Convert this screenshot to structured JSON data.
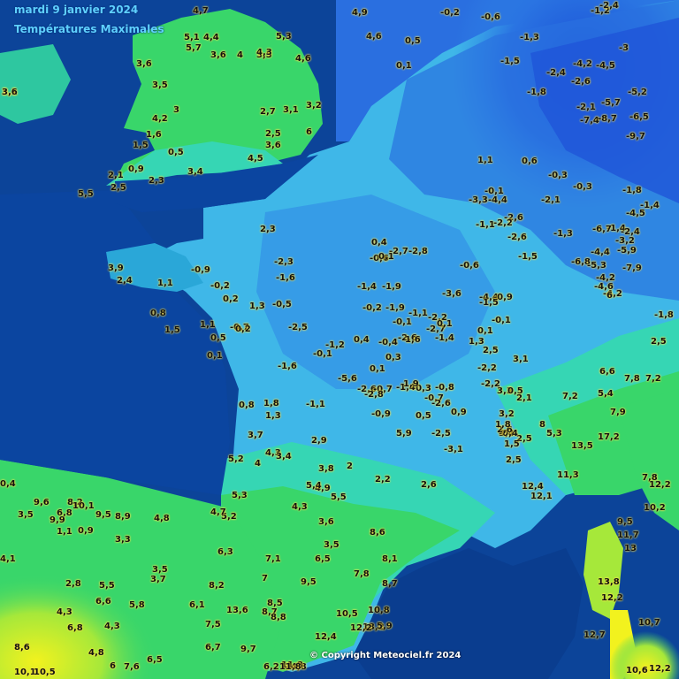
{
  "header": {
    "title": "mardi 9 janvier 2024",
    "subtitle": "Températures Maximales"
  },
  "footer": {
    "copyright": "© Copyright Meteociel.fr 2024"
  },
  "colors": {
    "sea": "#0a3d8f",
    "deep_cold": "#1a4fd6",
    "cold": "#2f86e6",
    "near_zero": "#3fb7e8",
    "mild": "#36d6b4",
    "warm": "#39d66a",
    "warmer": "#a6e83a",
    "hot": "#f2f21e",
    "label_text": "#111111",
    "label_halo": "#ffe14a"
  },
  "values": [
    {
      "t": "3,1"
    },
    {
      "t": "5,5"
    },
    {
      "t": "4,7"
    },
    {
      "t": "3,6"
    },
    {
      "t": "3,5"
    },
    {
      "t": "4,2"
    },
    {
      "t": "1,6"
    },
    {
      "t": "1,5"
    },
    {
      "t": "0,5"
    },
    {
      "t": "3"
    },
    {
      "t": "3,4"
    },
    {
      "t": "2,5"
    },
    {
      "t": "2,3"
    },
    {
      "t": "0,9"
    },
    {
      "t": "2,1"
    },
    {
      "t": "5,1"
    },
    {
      "t": "4,4"
    },
    {
      "t": "5,7"
    },
    {
      "t": "3,6"
    },
    {
      "t": "4"
    },
    {
      "t": "3,5"
    },
    {
      "t": "3,2"
    },
    {
      "t": "6"
    },
    {
      "t": "4,5"
    },
    {
      "t": "3,6"
    },
    {
      "t": "2,7"
    },
    {
      "t": "3,1"
    },
    {
      "t": "2,5"
    },
    {
      "t": "4,3"
    },
    {
      "t": "4,6"
    },
    {
      "t": "5,3"
    },
    {
      "t": "4,9"
    },
    {
      "t": "4,6"
    },
    {
      "t": "0,5"
    },
    {
      "t": "-0,2"
    },
    {
      "t": "0,1"
    },
    {
      "t": "-0,6"
    },
    {
      "t": "-1,3"
    },
    {
      "t": "-1,2"
    },
    {
      "t": "-2,4"
    },
    {
      "t": "-3"
    },
    {
      "t": "-4,2"
    },
    {
      "t": "-4,5"
    },
    {
      "t": "-5,2"
    },
    {
      "t": "-6,5"
    },
    {
      "t": "-7,4"
    },
    {
      "t": "-8,7"
    },
    {
      "t": "-9,7"
    },
    {
      "t": "-5,7"
    },
    {
      "t": "-2,4"
    },
    {
      "t": "-2,6"
    },
    {
      "t": "-1,5"
    },
    {
      "t": "-1,8"
    },
    {
      "t": "-2,1"
    },
    {
      "t": "-0,3"
    },
    {
      "t": "-1,4"
    },
    {
      "t": "-3,2"
    },
    {
      "t": "-5,9"
    },
    {
      "t": "-7,9"
    },
    {
      "t": "-6,8"
    },
    {
      "t": "-4,4"
    },
    {
      "t": "-4,2"
    },
    {
      "t": "-2,4"
    },
    {
      "t": "-1,8"
    },
    {
      "t": "-1,9"
    },
    {
      "t": "-2,7"
    },
    {
      "t": "-2,8"
    },
    {
      "t": "-2,3"
    },
    {
      "t": "-1,6"
    },
    {
      "t": "-0,5"
    },
    {
      "t": "-2,5"
    },
    {
      "t": "-1,2"
    },
    {
      "t": "-0,6"
    },
    {
      "t": "-0,2"
    },
    {
      "t": "0,4"
    },
    {
      "t": "-0,1"
    },
    {
      "t": "0,1"
    },
    {
      "t": "-0,8"
    },
    {
      "t": "-1,9"
    },
    {
      "t": "-2,6"
    },
    {
      "t": "-2,2"
    },
    {
      "t": "-1,4"
    },
    {
      "t": "-0,4"
    },
    {
      "t": "0,3"
    },
    {
      "t": "-0,3"
    },
    {
      "t": "0,9"
    },
    {
      "t": "1,3"
    },
    {
      "t": "0,8"
    },
    {
      "t": "1,5"
    },
    {
      "t": "2,3"
    },
    {
      "t": "3,9"
    },
    {
      "t": "2,4"
    },
    {
      "t": "1,1"
    },
    {
      "t": "-0,9"
    },
    {
      "t": "-0,2"
    },
    {
      "t": "0,2"
    },
    {
      "t": "1,1"
    },
    {
      "t": "0,1"
    },
    {
      "t": "0,5"
    },
    {
      "t": "-0,7"
    },
    {
      "t": "0,2"
    },
    {
      "t": "-1,6"
    },
    {
      "t": "-1,1"
    },
    {
      "t": "-0,9"
    },
    {
      "t": "-5,6"
    },
    {
      "t": "-2,6"
    },
    {
      "t": "-1,4"
    },
    {
      "t": "-0,7"
    },
    {
      "t": "0,8"
    },
    {
      "t": "1,3"
    },
    {
      "t": "1,8"
    },
    {
      "t": "2,9"
    },
    {
      "t": "3,7"
    },
    {
      "t": "4"
    },
    {
      "t": "5,2"
    },
    {
      "t": "4,3"
    },
    {
      "t": "3,4"
    },
    {
      "t": "3,8"
    },
    {
      "t": "2"
    },
    {
      "t": "2,2"
    },
    {
      "t": "2,6"
    },
    {
      "t": "4,9"
    },
    {
      "t": "5,4"
    },
    {
      "t": "5,5"
    },
    {
      "t": "4,3"
    },
    {
      "t": "3,6"
    },
    {
      "t": "3,5"
    },
    {
      "t": "5,2"
    },
    {
      "t": "5,3"
    },
    {
      "t": "4,7"
    },
    {
      "t": "6,3"
    },
    {
      "t": "7,1"
    },
    {
      "t": "6,5"
    },
    {
      "t": "8,6"
    },
    {
      "t": "8,1"
    },
    {
      "t": "7,8"
    },
    {
      "t": "8,7"
    },
    {
      "t": "10,8"
    },
    {
      "t": "13,2"
    },
    {
      "t": "12,4"
    },
    {
      "t": "14,8"
    },
    {
      "t": "11,8"
    },
    {
      "t": "12,2"
    },
    {
      "t": "10,5"
    },
    {
      "t": "8,7"
    },
    {
      "t": "8,8"
    },
    {
      "t": "13,6"
    },
    {
      "t": "9,7"
    },
    {
      "t": "7,5"
    },
    {
      "t": "6,1"
    },
    {
      "t": "5,8"
    },
    {
      "t": "4,3"
    },
    {
      "t": "6,6"
    },
    {
      "t": "6,8"
    },
    {
      "t": "4,3"
    },
    {
      "t": "2,8"
    },
    {
      "t": "1,1"
    },
    {
      "t": "0,9"
    },
    {
      "t": "6,8"
    },
    {
      "t": "8,2"
    },
    {
      "t": "9,6"
    },
    {
      "t": "9,9"
    },
    {
      "t": "10,1"
    },
    {
      "t": "9,5"
    },
    {
      "t": "8,9"
    },
    {
      "t": "4,8"
    },
    {
      "t": "3,5"
    },
    {
      "t": "5,5"
    },
    {
      "t": "3,7"
    },
    {
      "t": "3,3"
    },
    {
      "t": "4,1"
    },
    {
      "t": "0,4"
    },
    {
      "t": "3,5"
    },
    {
      "t": "8,6"
    },
    {
      "t": "4,8"
    },
    {
      "t": "6"
    },
    {
      "t": "7,6"
    },
    {
      "t": "6,5"
    },
    {
      "t": "10,1"
    },
    {
      "t": "10,5"
    },
    {
      "t": "6,2"
    },
    {
      "t": "11,8"
    },
    {
      "t": "8,2"
    },
    {
      "t": "7"
    },
    {
      "t": "8,5"
    },
    {
      "t": "9,5"
    },
    {
      "t": "6,7"
    },
    {
      "t": "5,9"
    },
    {
      "t": "7,8"
    },
    {
      "t": "12,2"
    },
    {
      "t": "10,2"
    },
    {
      "t": "11,3"
    },
    {
      "t": "13,5"
    },
    {
      "t": "12,4"
    },
    {
      "t": "12,1"
    },
    {
      "t": "9,5"
    },
    {
      "t": "11,7"
    },
    {
      "t": "13"
    },
    {
      "t": "13,8"
    },
    {
      "t": "12,2"
    },
    {
      "t": "10,7"
    },
    {
      "t": "12,7"
    },
    {
      "t": "10,6"
    },
    {
      "t": "12,2"
    },
    {
      "t": "17,2"
    },
    {
      "t": "5,4"
    },
    {
      "t": "7,8"
    },
    {
      "t": "7,2"
    },
    {
      "t": "6,6"
    },
    {
      "t": "7,9"
    },
    {
      "t": "7,2"
    },
    {
      "t": "8"
    },
    {
      "t": "5,3"
    },
    {
      "t": "3,4"
    },
    {
      "t": "2,5"
    },
    {
      "t": "2,5"
    },
    {
      "t": "-1,8"
    },
    {
      "t": "6"
    },
    {
      "t": "-4,2"
    },
    {
      "t": "-5,3"
    },
    {
      "t": "-4,6"
    },
    {
      "t": "-6,7"
    },
    {
      "t": "-4,5"
    },
    {
      "t": "-1,4"
    },
    {
      "t": "-1,3"
    },
    {
      "t": "-2,6"
    },
    {
      "t": "-1,5"
    },
    {
      "t": "-0,1"
    },
    {
      "t": "1,1"
    },
    {
      "t": "0,6"
    },
    {
      "t": "-0,3"
    },
    {
      "t": "-2,1"
    },
    {
      "t": "-4,4"
    },
    {
      "t": "-3,3"
    },
    {
      "t": "-2,6"
    },
    {
      "t": "-2,2"
    },
    {
      "t": "-1,1"
    },
    {
      "t": "-0,6"
    },
    {
      "t": "-3,6"
    },
    {
      "t": "-4,4"
    },
    {
      "t": "-0,9"
    },
    {
      "t": "-1,5"
    },
    {
      "t": "-0,1"
    },
    {
      "t": "0,1"
    },
    {
      "t": "1,3"
    },
    {
      "t": "2,5"
    },
    {
      "t": "3,1"
    },
    {
      "t": "3,3"
    },
    {
      "t": "5,9"
    },
    {
      "t": "0,5"
    },
    {
      "t": "-2,5"
    },
    {
      "t": "-3,1"
    },
    {
      "t": "-0,4"
    },
    {
      "t": "0,4"
    },
    {
      "t": "1,6"
    },
    {
      "t": "-2,7"
    },
    {
      "t": "-1,1"
    },
    {
      "t": "0,1"
    },
    {
      "t": "-0,1"
    },
    {
      "t": "1,9"
    },
    {
      "t": "-2,6"
    },
    {
      "t": "-0,7"
    },
    {
      "t": "-2,8"
    },
    {
      "t": "-1,4"
    },
    {
      "t": "0,1"
    },
    {
      "t": "-2,2"
    },
    {
      "t": "-2,2"
    },
    {
      "t": "0,5"
    },
    {
      "t": "2,1"
    },
    {
      "t": "3,2"
    },
    {
      "t": "2,6"
    },
    {
      "t": "1,8"
    },
    {
      "t": "1,5"
    },
    {
      "t": "2,5"
    },
    {
      "t": "3,6"
    }
  ]
}
